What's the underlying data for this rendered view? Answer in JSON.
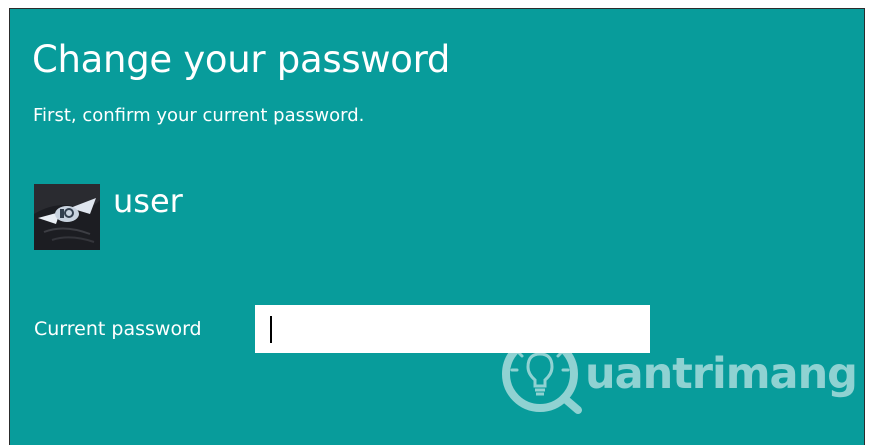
{
  "dialog": {
    "title": "Change your password",
    "subtitle": "First, confirm your current password.",
    "background_color": "#089c9b"
  },
  "account": {
    "username": "user",
    "avatar_icon": "user-avatar-photo"
  },
  "form": {
    "current_password_label": "Current password",
    "current_password_value": ""
  },
  "watermark": {
    "text": "uantrimang",
    "logo_icon": "lightbulb-icon"
  }
}
